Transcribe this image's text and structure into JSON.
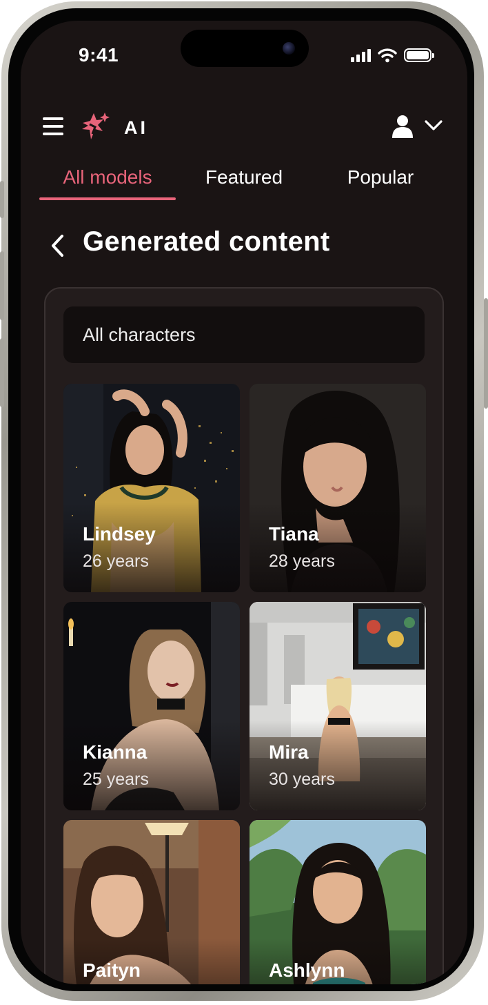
{
  "status_bar": {
    "time": "9:41"
  },
  "header": {
    "logo_text": "AI"
  },
  "tabs": [
    {
      "label": "All models",
      "active": true
    },
    {
      "label": "Featured",
      "active": false
    },
    {
      "label": "Popular",
      "active": false
    }
  ],
  "page": {
    "title": "Generated content"
  },
  "filter": {
    "selected": "All characters"
  },
  "characters": [
    {
      "name": "Lindsey",
      "age": "26 years"
    },
    {
      "name": "Tiana",
      "age": "28 years"
    },
    {
      "name": "Kianna",
      "age": "25 years"
    },
    {
      "name": "Mira",
      "age": "30 years"
    },
    {
      "name": "Paityn",
      "age": ""
    },
    {
      "name": "Ashlynn",
      "age": ""
    }
  ],
  "colors": {
    "accent": "#e8647a",
    "background": "#1a1414",
    "panel": "#231c1c"
  },
  "icons": [
    "hamburger-menu-icon",
    "logo-sparkle-icon",
    "user-icon",
    "chevron-down-icon",
    "back-chevron-icon",
    "signal-icon",
    "wifi-icon",
    "battery-icon"
  ]
}
